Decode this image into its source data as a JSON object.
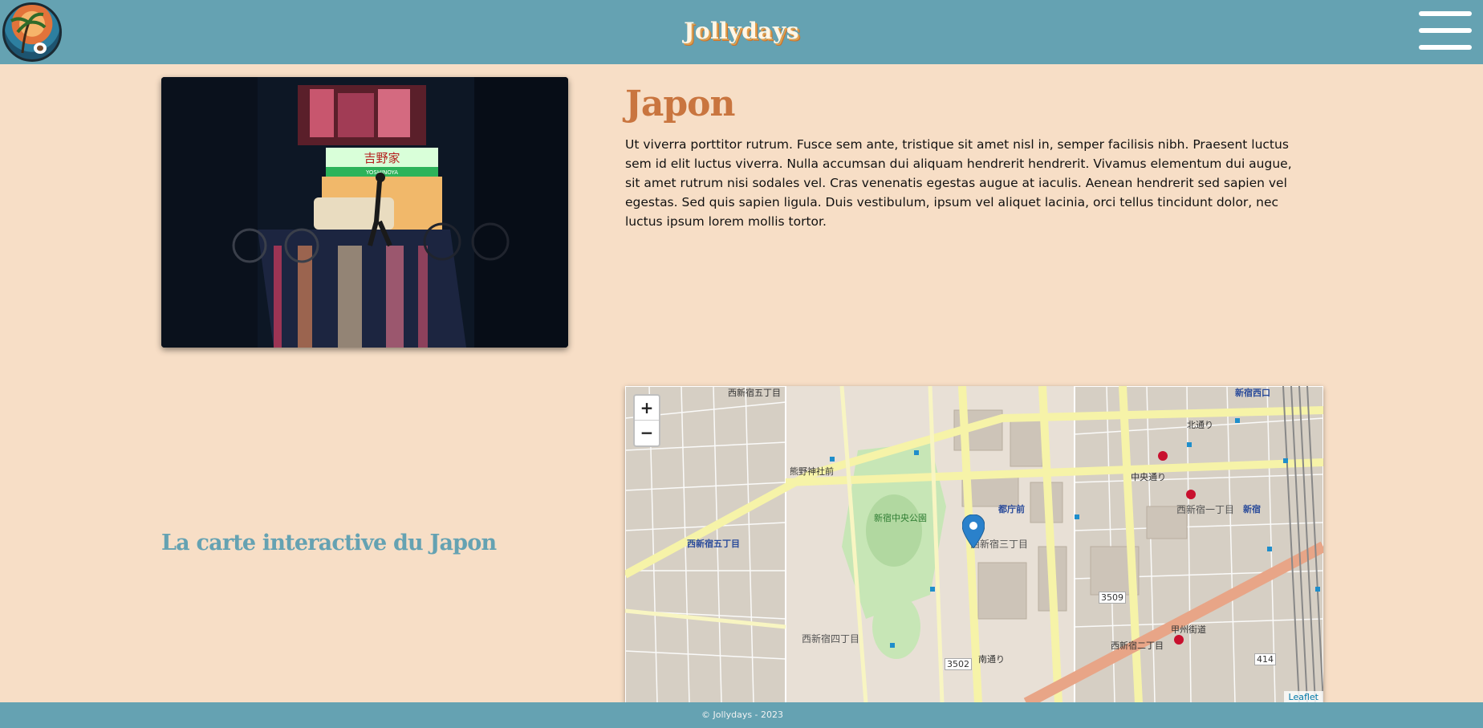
{
  "header": {
    "brand": "Jollydays",
    "logo_icon": "beach-palm-logo",
    "menu_icon": "hamburger-menu-icon"
  },
  "destination": {
    "title": "Japon",
    "description": "Ut viverra porttitor rutrum. Fusce sem ante, tristique sit amet nisl in, semper facilisis nibh. Praesent luctus sem id elit luctus viverra. Nulla accumsan dui aliquam hendrerit hendrerit. Vivamus elementum dui augue, sit amet rutrum nisi sodales vel. Cras venenatis egestas augue at iaculis. Aenean hendrerit sed sapien vel egestas. Sed quis sapien ligula. Duis vestibulum, ipsum vel aliquet lacinia, orci tellus tincidunt dolor, nec luctus ipsum lorem mollis tortor.",
    "photo_sign": "吉野家",
    "photo_sign_sub": "YOSHINOYA"
  },
  "map_section": {
    "label": "La carte interactive du Japon",
    "zoom_in": "+",
    "zoom_out": "−",
    "attribution": "Leaflet",
    "places": {
      "p1": "西新宿五丁目",
      "p2": "西新宿四丁目",
      "p3": "新宿中央公園",
      "p4": "西新宿三丁目",
      "p5": "都庁前",
      "p6": "西新宿一丁目",
      "p7": "新宿",
      "p8": "新宿西口",
      "p9": "西新宿二丁目",
      "p10": "北通り",
      "p11": "中央通り",
      "p12": "甲州街道",
      "p13": "3509",
      "p14": "3502",
      "p15": "414",
      "p16": "熊野神社前",
      "p17": "南通り"
    }
  },
  "footer": {
    "copyright": "© Jollydays - 2023"
  },
  "colors": {
    "header_bg": "#65a2b2",
    "page_bg": "#f7dec6",
    "title_color": "#c9753f",
    "marker": "#2a81cb"
  }
}
